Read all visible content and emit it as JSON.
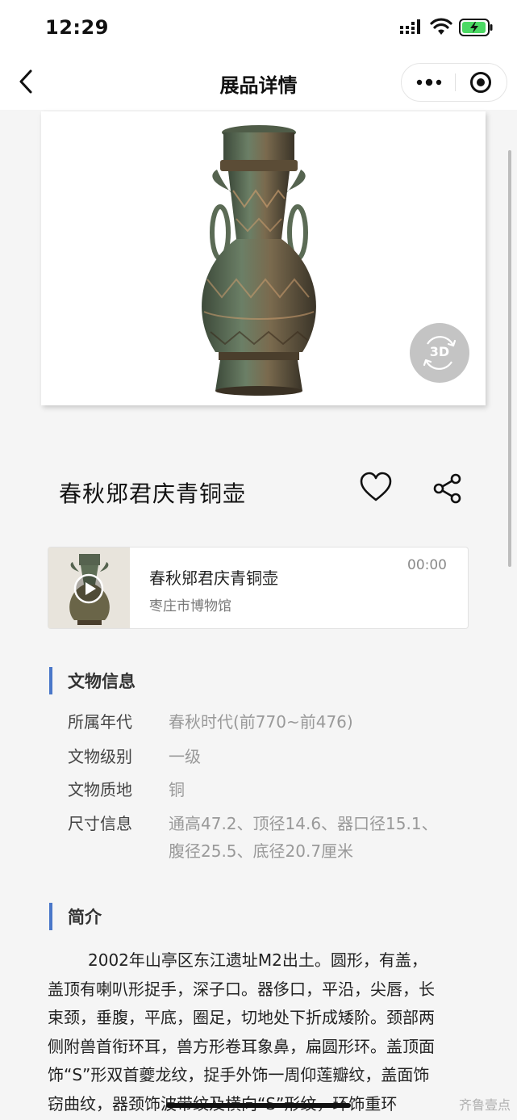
{
  "status_bar": {
    "time": "12:29"
  },
  "nav": {
    "title": "展品详情"
  },
  "hero": {
    "badge_3d": "3D"
  },
  "exhibit": {
    "title": "春秋郳君庆青铜壶"
  },
  "audio": {
    "title": "春秋郳君庆青铜壶",
    "subtitle": "枣庄市博物馆",
    "time": "00:00"
  },
  "info_section": {
    "title": "文物信息",
    "rows": [
      {
        "label": "所属年代",
        "value": "春秋时代(前770~前476)"
      },
      {
        "label": "文物级别",
        "value": "一级"
      },
      {
        "label": "文物质地",
        "value": "铜"
      },
      {
        "label": "尺寸信息",
        "value": "通高47.2、顶径14.6、器口径15.1、",
        "value2": "腹径25.5、底径20.7厘米"
      }
    ]
  },
  "intro_section": {
    "title": "简介",
    "lines": [
      "2002年山亭区东江遗址M2出土。圆形，有盖，",
      "盖顶有喇叭形捉手，深子口。器侈口，平沿，尖唇，长",
      "束颈，垂腹，平底，圈足，切地处下折成矮阶。颈部两",
      "侧附兽首衔环耳，兽方形卷耳象鼻，扁圆形环。盖顶面",
      "饰“S”形双首夔龙纹，捉手外饰一周仰莲瓣纹，盖面饰",
      "窃曲纹，器颈饰波带纹及横向“S”形纹，环饰重环"
    ]
  },
  "watermark": "齐鲁壹点",
  "colors": {
    "accent": "#4a77c9",
    "background": "#f5f5f5",
    "muted_text": "#999999",
    "bronze_green": "#5a7a5e",
    "bronze_brown": "#6b5238"
  }
}
